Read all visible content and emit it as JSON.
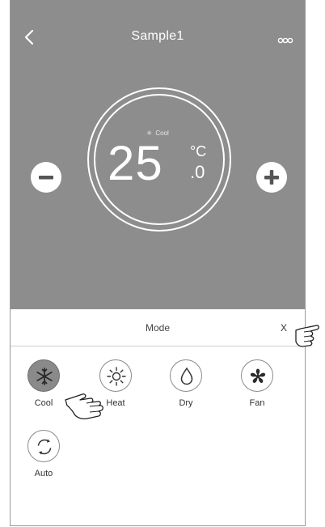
{
  "header": {
    "title": "Sample1",
    "back_icon": "chevron-left-icon",
    "more_icon": "more-dots-icon"
  },
  "thermostat": {
    "mode_indicator": "Cool",
    "mode_indicator_icon": "snowflake-icon",
    "temperature_integer": "25",
    "temperature_decimal": ".0",
    "unit": "°C",
    "decrease_icon": "minus-icon",
    "increase_icon": "plus-icon"
  },
  "mode_sheet": {
    "title": "Mode",
    "close_label": "X",
    "options": [
      {
        "label": "Cool",
        "icon": "snowflake-icon",
        "selected": true
      },
      {
        "label": "Heat",
        "icon": "sun-icon",
        "selected": false
      },
      {
        "label": "Dry",
        "icon": "droplet-icon",
        "selected": false
      },
      {
        "label": "Fan",
        "icon": "fan-icon",
        "selected": false
      },
      {
        "label": "Auto",
        "icon": "cycle-arrows-icon",
        "selected": false
      }
    ]
  },
  "colors": {
    "top_background": "#8d8d8d",
    "selected_mode": "#8a8a8a",
    "text_white": "#ffffff"
  }
}
